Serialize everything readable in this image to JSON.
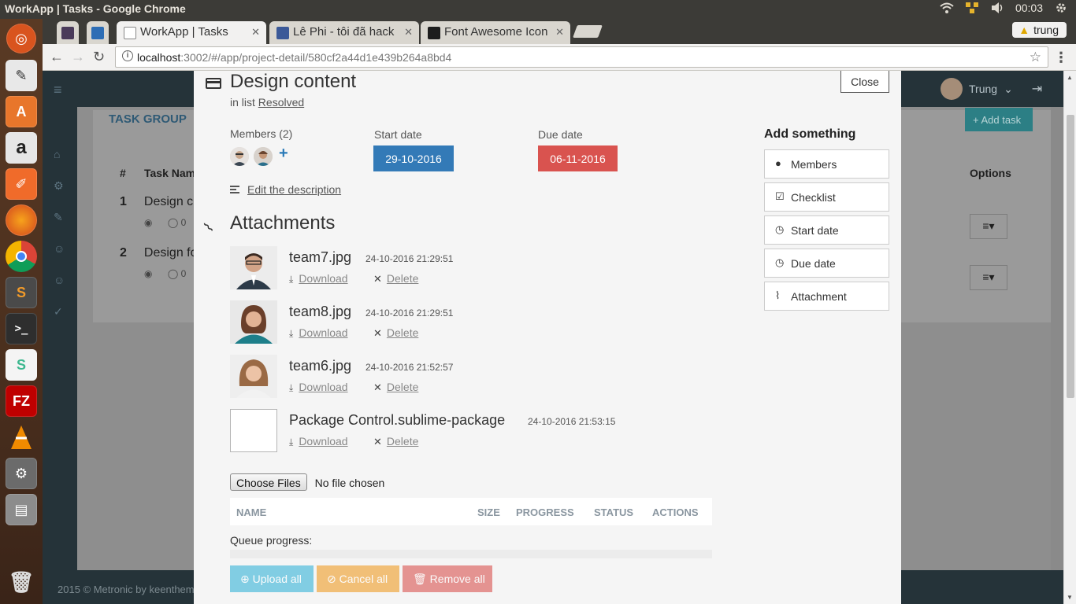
{
  "os": {
    "window_title": "WorkApp | Tasks - Google Chrome",
    "clock": "00:03"
  },
  "launcher": {
    "items": [
      "ubuntu-dash",
      "text-editor",
      "software-center",
      "amazon",
      "gimp-app",
      "firefox",
      "chrome",
      "sublime-text",
      "terminal",
      "slack",
      "filezilla",
      "vlc",
      "system-settings",
      "files",
      "trash"
    ]
  },
  "browser": {
    "tabs": [
      {
        "label": "",
        "active": false
      },
      {
        "label": "",
        "active": false
      },
      {
        "label": "WorkApp | Tasks",
        "active": true
      },
      {
        "label": "Lê Phi - tôi đã hack",
        "active": false
      },
      {
        "label": "Font Awesome Icon",
        "active": false
      }
    ],
    "profile_name": "trung",
    "url_host": "localhost",
    "url_path": ":3002/#/app/project-detail/580cf2a44d1e439b264a8bd4"
  },
  "background_app": {
    "user_name": "Trung",
    "task_group_title": "TASK GROUP",
    "add_task_label": "+ Add task",
    "columns": {
      "number": "#",
      "task_name": "Task Nam",
      "options": "Options"
    },
    "rows": [
      {
        "number": "1",
        "name": "Design c",
        "views": "",
        "comments": "0"
      },
      {
        "number": "2",
        "name": "Design fo",
        "views": "",
        "comments": "0"
      }
    ],
    "footer": "2015 © Metronic by keenthem"
  },
  "modal": {
    "title": "Design content",
    "in_list_prefix": "in list",
    "list_name": "Resolved",
    "close_label": "Close",
    "members_label": "Members (2)",
    "start_date_label": "Start date",
    "start_date_value": "29-10-2016",
    "due_date_label": "Due date",
    "due_date_value": "06-11-2016",
    "edit_description": "Edit the description",
    "attachments_title": "Attachments",
    "attachments": [
      {
        "name": "team7.jpg",
        "date": "24-10-2016 21:29:51",
        "download": "Download",
        "delete": "Delete"
      },
      {
        "name": "team8.jpg",
        "date": "24-10-2016 21:29:51",
        "download": "Download",
        "delete": "Delete"
      },
      {
        "name": "team6.jpg",
        "date": "24-10-2016 21:52:57",
        "download": "Download",
        "delete": "Delete"
      },
      {
        "name": "Package Control.sublime-package",
        "date": "24-10-2016 21:53:15",
        "download": "Download",
        "delete": "Delete"
      }
    ],
    "choose_files_label": "Choose Files",
    "no_file_chosen": "No file chosen",
    "queue_columns": {
      "name": "NAME",
      "size": "SIZE",
      "progress": "PROGRESS",
      "status": "STATUS",
      "actions": "ACTIONS"
    },
    "queue_progress_label": "Queue progress:",
    "upload_all": "Upload all",
    "cancel_all": "Cancel all",
    "remove_all": "Remove all",
    "add_something_title": "Add something",
    "add_items": [
      {
        "label": "Members",
        "icon": "user-icon"
      },
      {
        "label": "Checklist",
        "icon": "checkbox-icon"
      },
      {
        "label": "Start date",
        "icon": "clock-icon"
      },
      {
        "label": "Due date",
        "icon": "clock-icon"
      },
      {
        "label": "Attachment",
        "icon": "paperclip-icon"
      }
    ]
  },
  "colors": {
    "start_date_badge": "#337ab7",
    "due_date_badge": "#d9534f",
    "upload_all": "#5bc0de",
    "cancel_all": "#f0ad4e",
    "remove_all": "#d9534f"
  }
}
